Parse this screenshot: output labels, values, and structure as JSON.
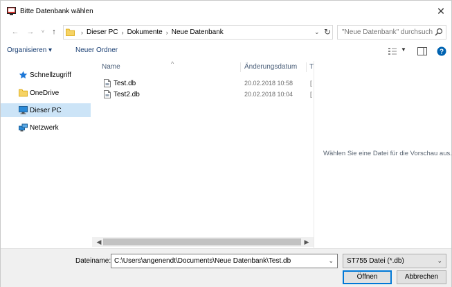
{
  "window": {
    "title": "Bitte Datenbank wählen",
    "close_symbol": "✕"
  },
  "nav": {
    "back_icon": "←",
    "forward_icon": "→",
    "recent_icon": "˅",
    "up_icon": "↑"
  },
  "address": {
    "crumbs": [
      "Dieser PC",
      "Dokumente",
      "Neue Datenbank"
    ],
    "separator": "›"
  },
  "search": {
    "placeholder": "\"Neue Datenbank\" durchsuch..."
  },
  "toolbar": {
    "organize_label": "Organisieren ▾",
    "new_folder_label": "Neuer Ordner"
  },
  "navpane": {
    "items": [
      {
        "label": "Schnellzugriff",
        "icon": "star-icon"
      },
      {
        "label": "OneDrive",
        "icon": "folder-icon"
      },
      {
        "label": "Dieser PC",
        "icon": "monitor-icon",
        "selected": true
      },
      {
        "label": "Netzwerk",
        "icon": "network-icon"
      }
    ]
  },
  "filelist": {
    "columns": [
      "Name",
      "Änderungsdatum",
      "T"
    ],
    "sort_indicator": "^",
    "files": [
      {
        "name": "Test.db",
        "date": "20.02.2018 10:58",
        "more": "["
      },
      {
        "name": "Test2.db",
        "date": "20.02.2018 10:04",
        "more": "["
      }
    ]
  },
  "preview": {
    "message": "Wählen Sie eine Datei für die Vorschau aus."
  },
  "bottom": {
    "filename_label": "Dateiname:",
    "filename_value": "C:\\Users\\angenendt\\Documents\\Neue Datenbank\\Test.db",
    "filetype": "ST755 Datei (*.db)",
    "open_label": "Öffnen",
    "cancel_label": "Abbrechen"
  },
  "colors": {
    "selection": "#cce4f7",
    "link": "#1a3f73",
    "help": "#0063b1",
    "primary_border": "#0078d7"
  }
}
